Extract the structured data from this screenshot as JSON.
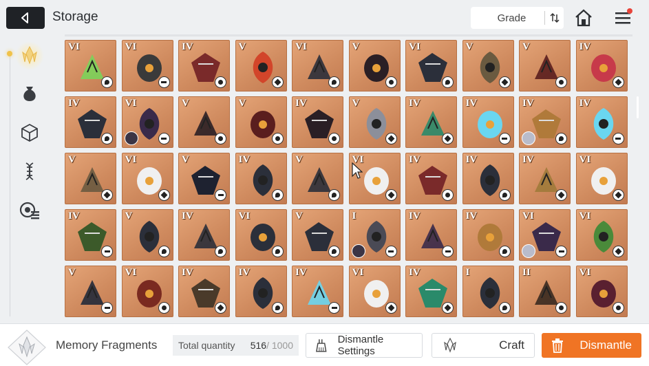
{
  "header": {
    "title": "Storage",
    "sort": {
      "label": "Grade"
    }
  },
  "sidebar": {
    "items": [
      {
        "name": "memory-fragment-tab",
        "icon": "crystal-icon",
        "active": true
      },
      {
        "name": "materials-tab",
        "icon": "pouch-icon",
        "active": false
      },
      {
        "name": "cube-tab",
        "icon": "cube-icon",
        "active": false
      },
      {
        "name": "helix-tab",
        "icon": "helix-icon",
        "active": false
      },
      {
        "name": "settings-tab",
        "icon": "gear-list-icon",
        "active": false
      }
    ]
  },
  "grid": {
    "items": [
      {
        "grade": "VI",
        "type": 1,
        "color": "#7bd35a"
      },
      {
        "grade": "VI",
        "type": 3,
        "color": "#3a3a3a"
      },
      {
        "grade": "IV",
        "type": 4,
        "color": "#7a2a2a"
      },
      {
        "grade": "V",
        "type": 2,
        "color": "#d2452a"
      },
      {
        "grade": "VI",
        "type": 1,
        "color": "#2b2f3a"
      },
      {
        "grade": "V",
        "type": 4,
        "color": "#2a1f25"
      },
      {
        "grade": "VI",
        "type": 1,
        "color": "#2b2f3a"
      },
      {
        "grade": "V",
        "type": 2,
        "color": "#6a5a40"
      },
      {
        "grade": "V",
        "type": 4,
        "color": "#5a1e1e"
      },
      {
        "grade": "IV",
        "type": 2,
        "color": "#c73a4a"
      },
      {
        "grade": "IV",
        "type": 1,
        "color": "#2b2f3a"
      },
      {
        "grade": "VI",
        "type": 3,
        "color": "#3a2a4a",
        "portrait": "dark"
      },
      {
        "grade": "V",
        "type": 4,
        "color": "#2a1f25"
      },
      {
        "grade": "V",
        "type": 4,
        "color": "#5a1e1e"
      },
      {
        "grade": "IV",
        "type": 4,
        "color": "#2a1f25"
      },
      {
        "grade": "V",
        "type": 2,
        "color": "#8c8f9a"
      },
      {
        "grade": "IV",
        "type": 2,
        "color": "#2a8a6a"
      },
      {
        "grade": "IV",
        "type": 3,
        "color": "#6ad6f0"
      },
      {
        "grade": "IV",
        "type": 1,
        "color": "#b07a3a",
        "portrait": "light"
      },
      {
        "grade": "IV",
        "type": 3,
        "color": "#6ad6f0"
      },
      {
        "grade": "V",
        "type": 2,
        "color": "#6a5a40"
      },
      {
        "grade": "VI",
        "type": 2,
        "color": "#f0f0f0"
      },
      {
        "grade": "V",
        "type": 3,
        "color": "#1e2230"
      },
      {
        "grade": "IV",
        "type": 1,
        "color": "#2b2f3a"
      },
      {
        "grade": "V",
        "type": 1,
        "color": "#2b2f3a"
      },
      {
        "grade": "VI",
        "type": 2,
        "color": "#f0f0f0"
      },
      {
        "grade": "IV",
        "type": 4,
        "color": "#7a2a2a"
      },
      {
        "grade": "IV",
        "type": 1,
        "color": "#2b2f3a"
      },
      {
        "grade": "IV",
        "type": 2,
        "color": "#a07a3a"
      },
      {
        "grade": "VI",
        "type": 2,
        "color": "#f0f0f0"
      },
      {
        "grade": "IV",
        "type": 3,
        "color": "#3c5a2a"
      },
      {
        "grade": "V",
        "type": 1,
        "color": "#2b2f3a"
      },
      {
        "grade": "IV",
        "type": 1,
        "color": "#2b2f3a"
      },
      {
        "grade": "VI",
        "type": 1,
        "color": "#2b2f3a"
      },
      {
        "grade": "V",
        "type": 1,
        "color": "#2b2f3a"
      },
      {
        "grade": "I",
        "type": 3,
        "color": "#4a4a55",
        "portrait": "dark"
      },
      {
        "grade": "IV",
        "type": 3,
        "color": "#3a2a4a"
      },
      {
        "grade": "IV",
        "type": 1,
        "color": "#b07a3a"
      },
      {
        "grade": "VI",
        "type": 3,
        "color": "#3a2a4a",
        "portrait": "light"
      },
      {
        "grade": "VI",
        "type": 2,
        "color": "#4a8a3a"
      },
      {
        "grade": "V",
        "type": 3,
        "color": "#222a3a"
      },
      {
        "grade": "VI",
        "type": 4,
        "color": "#7a2a20"
      },
      {
        "grade": "IV",
        "type": 2,
        "color": "#4a3a2a"
      },
      {
        "grade": "IV",
        "type": 1,
        "color": "#2b2f3a"
      },
      {
        "grade": "IV",
        "type": 3,
        "color": "#6ad6f0"
      },
      {
        "grade": "VI",
        "type": 2,
        "color": "#f0f0f0"
      },
      {
        "grade": "IV",
        "type": 2,
        "color": "#2a8a6a"
      },
      {
        "grade": "I",
        "type": 1,
        "color": "#2b2f3a"
      },
      {
        "grade": "II",
        "type": 4,
        "color": "#3a2a20"
      },
      {
        "grade": "VI",
        "type": 4,
        "color": "#5a2030"
      }
    ]
  },
  "footer": {
    "fragment_label": "Memory Fragments",
    "quantity_label": "Total quantity",
    "quantity_value": "516",
    "quantity_max": " / 1000",
    "settings_label": "Dismantle Settings",
    "craft_label": "Craft",
    "dismantle_label": "Dismantle",
    "accent": "#f07424"
  }
}
